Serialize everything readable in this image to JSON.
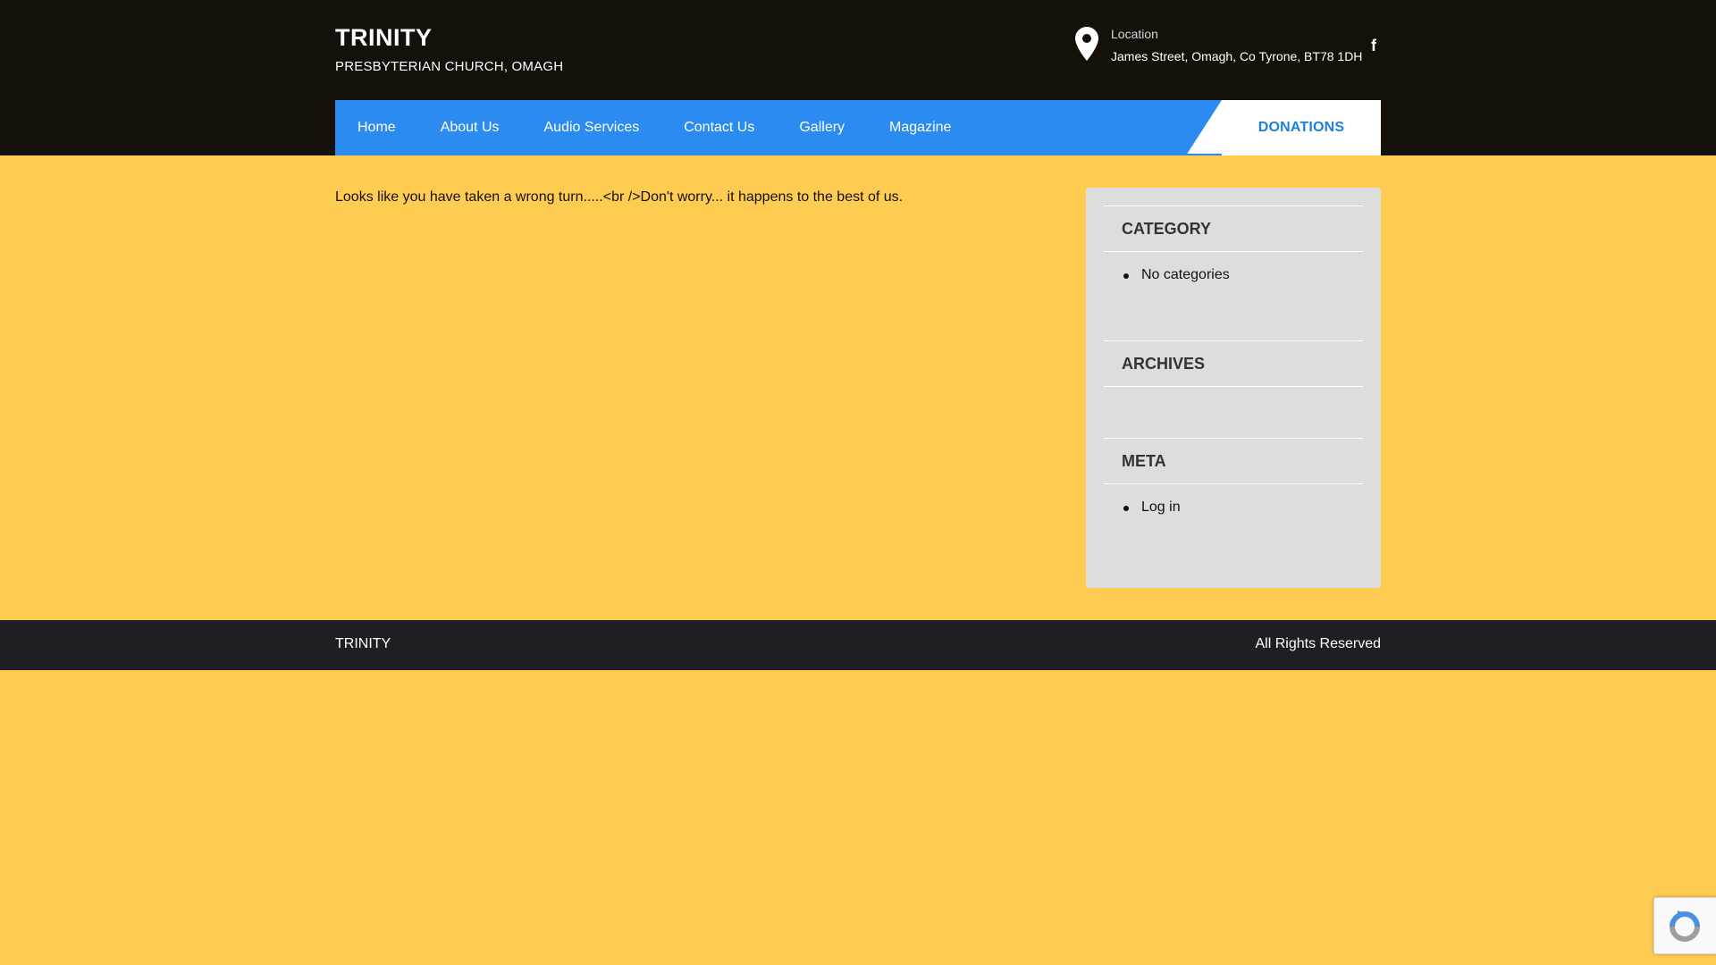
{
  "header": {
    "title": "TRINITY",
    "subtitle": "PRESBYTERIAN CHURCH, OMAGH",
    "location_label": "Location",
    "location_address": "James Street, Omagh, Co Tyrone, BT78 1DH",
    "social_facebook": "f"
  },
  "nav": {
    "items": [
      {
        "label": "Home"
      },
      {
        "label": "About Us"
      },
      {
        "label": "Audio Services"
      },
      {
        "label": "Contact Us"
      },
      {
        "label": "Gallery"
      },
      {
        "label": "Magazine"
      }
    ],
    "donate_label": "DONATIONS"
  },
  "main": {
    "message": "Looks like you have taken a wrong turn.....<br />Don't worry... it happens to the best of us."
  },
  "sidebar": {
    "category_title": "CATEGORY",
    "category_items": [
      "No categories"
    ],
    "archives_title": "ARCHIVES",
    "meta_title": "META",
    "meta_items": [
      "Log in"
    ]
  },
  "footer": {
    "left": "TRINITY",
    "right": "All Rights Reserved"
  },
  "colors": {
    "page_bg": "#ffcc52",
    "header_bg": "#15110a",
    "nav_bg": "#2b8bf0",
    "donate_text": "#1f7fdc",
    "footer_bg": "#1d1f23",
    "sidebar_bg": "#dddddd"
  }
}
